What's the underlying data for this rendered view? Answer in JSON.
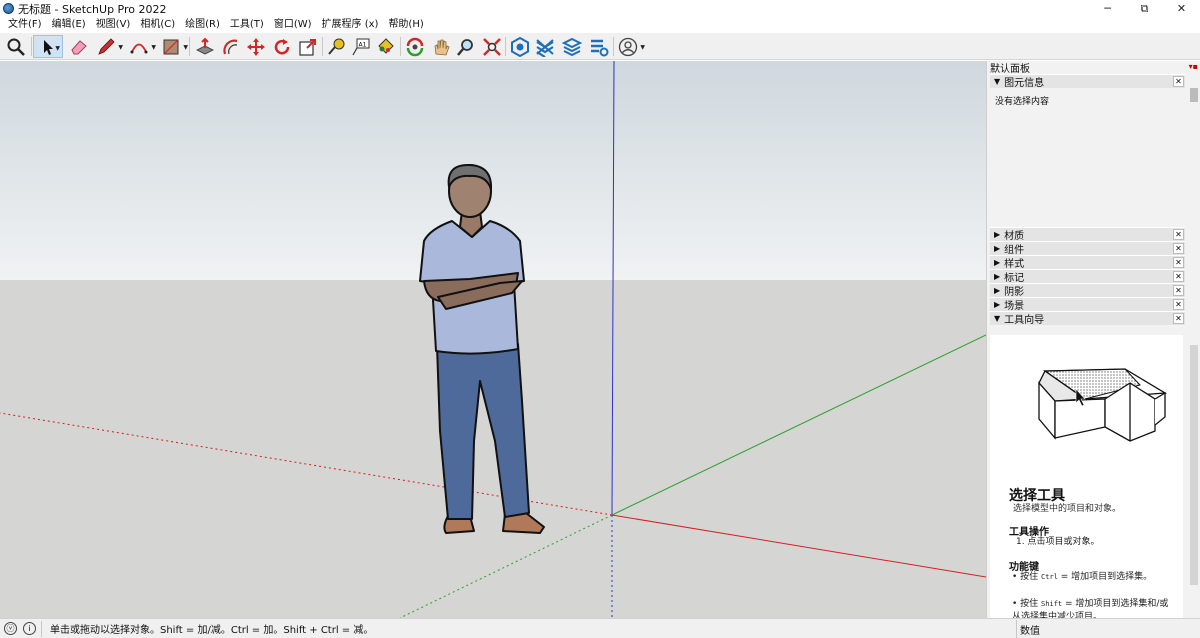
{
  "window": {
    "title": "无标题 - SketchUp Pro 2022",
    "controls": {
      "minimize": "─",
      "restore": "⧉",
      "close": "✕"
    }
  },
  "menu": [
    "文件(F)",
    "编辑(E)",
    "视图(V)",
    "相机(C)",
    "绘图(R)",
    "工具(T)",
    "窗口(W)",
    "扩展程序 (x)",
    "帮助(H)"
  ],
  "toolbar": {
    "tools": [
      {
        "icon": "search-icon"
      },
      {
        "icon": "select-arrow-icon",
        "active": true
      },
      {
        "icon": "eraser-icon"
      },
      {
        "icon": "pencil-icon"
      },
      {
        "icon": "arc-icon"
      },
      {
        "icon": "rectangle-icon"
      },
      {
        "icon": "push-pull-icon"
      },
      {
        "icon": "offset-icon"
      },
      {
        "icon": "move-icon"
      },
      {
        "icon": "rotate-icon"
      },
      {
        "icon": "scale-icon"
      },
      {
        "icon": "tape-measure-icon"
      },
      {
        "icon": "text-icon"
      },
      {
        "icon": "paint-bucket-icon"
      },
      {
        "icon": "orbit-icon"
      },
      {
        "icon": "pan-icon"
      },
      {
        "icon": "zoom-icon"
      },
      {
        "icon": "zoom-extents-icon"
      },
      {
        "icon": "3d-warehouse-icon"
      },
      {
        "icon": "extension-warehouse-icon"
      },
      {
        "icon": "layout-icon"
      },
      {
        "icon": "extension-manager-icon"
      },
      {
        "icon": "account-icon"
      }
    ],
    "text_tool_label": "A1"
  },
  "tray": {
    "title": "默认面板",
    "entity_info": {
      "label": "图元信息",
      "content": "没有选择内容"
    },
    "panels": [
      "材质",
      "组件",
      "样式",
      "标记",
      "阴影",
      "场景"
    ],
    "instructor": {
      "label": "工具向导",
      "tool_name": "选择工具",
      "tool_desc": "选择模型中的项目和对象。",
      "ops_heading": "工具操作",
      "ops": [
        "1. 点击项目或对象。"
      ],
      "modifier_heading": "功能键",
      "modifier_1": {
        "pre": "按住 ",
        "key": "Ctrl",
        "post": " = 增加项目到选择集。"
      },
      "modifier_2": {
        "pre": "按住 ",
        "key": "Shift",
        "post": " = 增加项目到选择集和/或从选择集中减少项目。"
      }
    }
  },
  "status": {
    "icons": [
      "geo-location-icon",
      "info-icon"
    ],
    "message": "单击或拖动以选择对象。Shift = 加/减。Ctrl = 加。Shift + Ctrl = 减。",
    "measurement_label": "数值"
  },
  "colors": {
    "axis_red": "#d42020",
    "axis_green": "#2aa02a",
    "axis_blue": "#3030c8",
    "selected_tool": "#cfe3f5"
  }
}
